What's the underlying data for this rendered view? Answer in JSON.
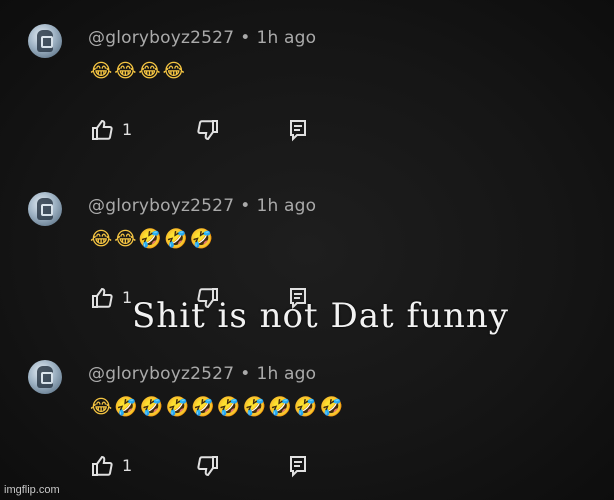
{
  "comments": [
    {
      "username": "@gloryboyz2527",
      "separator": "•",
      "time": "1h ago",
      "emojis": "😂😂😂😂",
      "likes": "1"
    },
    {
      "username": "@gloryboyz2527",
      "separator": "•",
      "time": "1h ago",
      "emojis": "😂😂🤣🤣🤣",
      "likes": "1"
    },
    {
      "username": "@gloryboyz2527",
      "separator": "•",
      "time": "1h ago",
      "emojis": "😂🤣🤣🤣🤣🤣🤣🤣🤣🤣",
      "likes": "1"
    }
  ],
  "caption": "Shit is not Dat funny",
  "watermark": "imgflip.com",
  "icons": {
    "like": "thumbs-up-icon",
    "dislike": "thumbs-down-icon",
    "reply": "reply-icon"
  },
  "colors": {
    "background": "#141414",
    "username": "#aaaaaa",
    "text": "#e0e0e0"
  }
}
